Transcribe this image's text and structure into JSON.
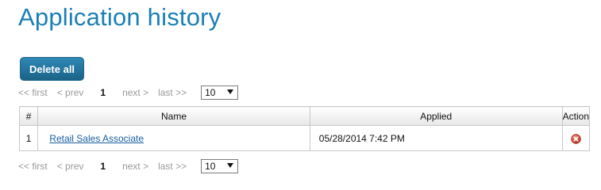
{
  "page": {
    "title": "Application history"
  },
  "toolbar": {
    "delete_all_label": "Delete all"
  },
  "pagination": {
    "first": "<< first",
    "prev": "< prev",
    "current_page": "1",
    "next": "next >",
    "last": "last >>",
    "page_size": "10"
  },
  "table": {
    "headers": {
      "number": "#",
      "name": "Name",
      "applied": "Applied",
      "action": "Action"
    },
    "rows": [
      {
        "number": "1",
        "name": "Retail Sales Associate",
        "applied": "05/28/2014 7:42 PM",
        "action_icon": "delete-x-icon"
      }
    ]
  },
  "colors": {
    "title": "#1a7fb5",
    "button_top": "#2e88b6",
    "button_bottom": "#1b6387",
    "link": "#1a5fa0",
    "delete_icon": "#c0392b"
  }
}
